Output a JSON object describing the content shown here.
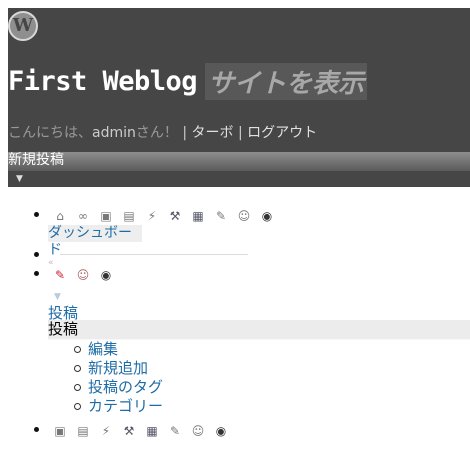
{
  "header": {
    "logo_glyph": "W",
    "site_title": "First Weblog",
    "view_site_label": "サイトを表示",
    "greeting_prefix": "こんにちは、",
    "username": "admin",
    "greeting_suffix": "さん！",
    "separator": "|",
    "turbo_label": "ターボ",
    "logout_label": "ログアウト"
  },
  "favorites": {
    "label": "新規投稿",
    "toggle_glyph": "▼"
  },
  "menu": {
    "top_icons": [
      "home-icon",
      "links-icon",
      "media-icon",
      "pages-icon",
      "plugins-icon",
      "tools-icon",
      "settings-icon",
      "posts-icon",
      "users-icon",
      "appearance-icon"
    ],
    "dashboard_label": "ダッシュボード",
    "collapse_glyph": "«",
    "middle_icons": [
      "posts-icon",
      "users-icon",
      "appearance-icon"
    ],
    "posts_arrow_glyph": "▼",
    "posts_link_label": "投稿",
    "posts_header_label": "投稿",
    "posts_submenu": [
      "編集",
      "新規追加",
      "投稿のタグ",
      "カテゴリー"
    ],
    "bottom_icons": [
      "media-icon",
      "pages-icon",
      "plugins-icon",
      "tools-icon",
      "settings-icon",
      "posts-icon",
      "users-icon",
      "appearance-icon"
    ]
  },
  "icon_glyphs": {
    "home-icon": "⌂",
    "links-icon": "∞",
    "media-icon": "▣",
    "pages-icon": "▤",
    "plugins-icon": "⚡",
    "tools-icon": "⚒",
    "settings-icon": "▦",
    "posts-icon": "✎",
    "users-icon": "☺",
    "appearance-icon": "◉"
  },
  "colors": {
    "header_bg": "#464646",
    "link": "#1e6ca6",
    "favorites_bar": "#7a7a7a"
  }
}
